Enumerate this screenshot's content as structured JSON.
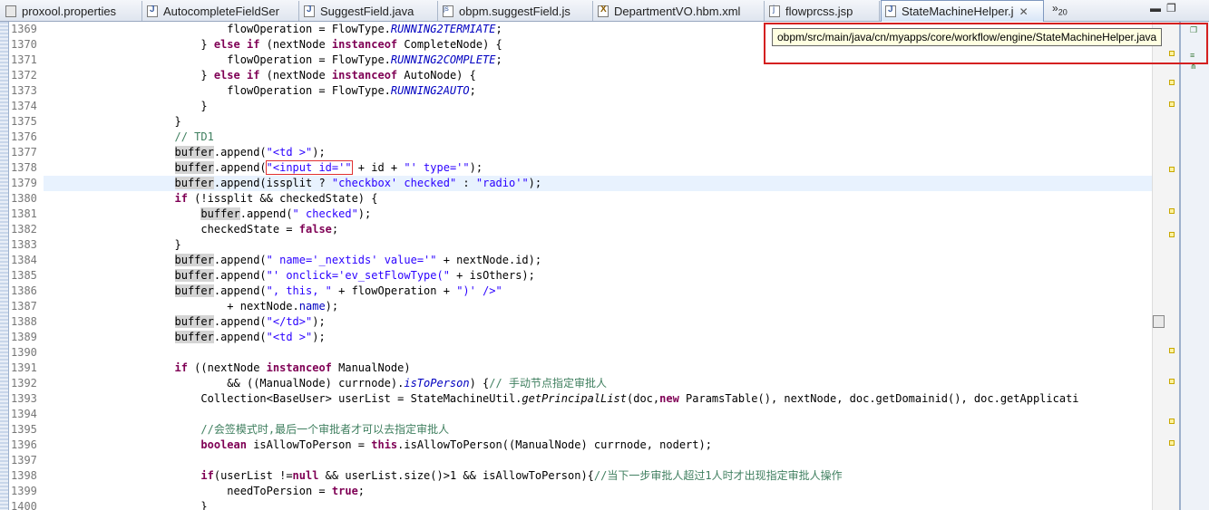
{
  "tabs": [
    {
      "label": "proxool.properties",
      "icon": "properties-file-icon",
      "active": false
    },
    {
      "label": "AutocompleteFieldSer",
      "icon": "java-file-icon",
      "active": false
    },
    {
      "label": "SuggestField.java",
      "icon": "java-file-icon",
      "active": false
    },
    {
      "label": "obpm.suggestField.js",
      "icon": "js-file-icon",
      "active": false
    },
    {
      "label": "DepartmentVO.hbm.xml",
      "icon": "xml-file-icon",
      "active": false
    },
    {
      "label": "flowprcss.jsp",
      "icon": "jsp-file-icon",
      "active": false
    },
    {
      "label": "StateMachineHelper.j",
      "icon": "java-file-icon",
      "active": true
    }
  ],
  "tab_overflow": {
    "symbol": "»",
    "count": "20"
  },
  "tooltip": {
    "text": "obpm/src/main/java/cn/myapps/core/workflow/engine/StateMachineHelper.java"
  },
  "editor": {
    "current_line": "1379",
    "line_numbers": [
      "1369",
      "1370",
      "1371",
      "1372",
      "1373",
      "1374",
      "1375",
      "1376",
      "1377",
      "1378",
      "1379",
      "1380",
      "1381",
      "1382",
      "1383",
      "1384",
      "1385",
      "1386",
      "1387",
      "1388",
      "1389",
      "1390",
      "1391",
      "1392",
      "1393",
      "1394",
      "1395",
      "1396",
      "1397",
      "1398",
      "1399",
      "1400"
    ]
  },
  "code": {
    "l1369": {
      "pre": "                            flowOperation = FlowType.",
      "f": "RUNNING2TERMIATE",
      "post": ";"
    },
    "l1370": {
      "pre": "                        } ",
      "k1": "else if",
      "mid": " (nextNode ",
      "k2": "instanceof",
      "post": " CompleteNode) {"
    },
    "l1371": {
      "pre": "                            flowOperation = FlowType.",
      "f": "RUNNING2COMPLETE",
      "post": ";"
    },
    "l1372": {
      "pre": "                        } ",
      "k1": "else if",
      "mid": " (nextNode ",
      "k2": "instanceof",
      "post": " AutoNode) {"
    },
    "l1373": {
      "pre": "                            flowOperation = FlowType.",
      "f": "RUNNING2AUTO",
      "post": ";"
    },
    "l1374": {
      "text": "                        }"
    },
    "l1375": {
      "text": "                    }"
    },
    "l1376": {
      "pre": "                    ",
      "c": "// TD1"
    },
    "l1377": {
      "pre": "                    ",
      "v": "buffer",
      "mid": ".append(",
      "s": "\"<td >\"",
      "post": ");"
    },
    "l1378": {
      "pre": "                    ",
      "v": "buffer",
      "mid": ".append(",
      "s": "\"<input id='\"",
      "mid2": " + id + ",
      "s2": "\"' type='\"",
      "post": ");"
    },
    "l1379": {
      "pre": "                    ",
      "v": "buffer",
      "mid": ".append(issplit ? ",
      "s": "\"checkbox' checked\"",
      "mid2": " : ",
      "s2": "\"radio'\"",
      "post": ");"
    },
    "l1380": {
      "pre": "                    ",
      "k1": "if",
      "post": " (!issplit && checkedState) {"
    },
    "l1381": {
      "pre": "                        ",
      "v": "buffer",
      "mid": ".append(",
      "s": "\" checked\"",
      "post": ");"
    },
    "l1382": {
      "pre": "                        checkedState = ",
      "k1": "false",
      "post": ";"
    },
    "l1383": {
      "text": "                    }"
    },
    "l1384": {
      "pre": "                    ",
      "v": "buffer",
      "mid": ".append(",
      "s": "\" name='_nextids' value='\"",
      "post": " + nextNode.id);"
    },
    "l1385": {
      "pre": "                    ",
      "v": "buffer",
      "mid": ".append(",
      "s": "\"' onclick='ev_setFlowType(\"",
      "post": " + isOthers);"
    },
    "l1386": {
      "pre": "                    ",
      "v": "buffer",
      "mid": ".append(",
      "s": "\", this, \"",
      "mid2": " + flowOperation + ",
      "s2": "\")' />\""
    },
    "l1387": {
      "pre": "                            + nextNode.",
      "f": "name",
      "post": ");"
    },
    "l1388": {
      "pre": "                    ",
      "v": "buffer",
      "mid": ".append(",
      "s": "\"</td>\"",
      "post": ");"
    },
    "l1389": {
      "pre": "                    ",
      "v": "buffer",
      "mid": ".append(",
      "s": "\"<td >\"",
      "post": ");"
    },
    "l1390": {
      "text": ""
    },
    "l1391": {
      "pre": "                    ",
      "k1": "if",
      "mid": " ((nextNode ",
      "k2": "instanceof",
      "post": " ManualNode)"
    },
    "l1392": {
      "pre": "                            && ((ManualNode) currnode).",
      "f": "isToPerson",
      "mid": ") {",
      "c": "// 手动节点指定审批人"
    },
    "l1393": {
      "pre": "                        Collection<BaseUser> userList = StateMachineUtil.",
      "m": "getPrincipalList",
      "mid": "(doc,",
      "k1": "new",
      "post": " ParamsTable(), nextNode, doc.getDomainid(), doc.getApplicati"
    },
    "l1394": {
      "text": ""
    },
    "l1395": {
      "pre": "                        ",
      "c": "//会签模式时,最后一个审批者才可以去指定审批人"
    },
    "l1396": {
      "pre": "                        ",
      "k1": "boolean",
      "mid": " isAllowToPerson = ",
      "k2": "this",
      "post": ".isAllowToPerson((ManualNode) currnode, nodert);"
    },
    "l1397": {
      "text": ""
    },
    "l1398": {
      "pre": "                        ",
      "k1": "if",
      "mid": "(userList !=",
      "k2": "null",
      "post": " && userList.size()>1 && isAllowToPerson){",
      "c": "//当下一步审批人超过1人时才出现指定审批人操作"
    },
    "l1399": {
      "pre": "                            needToPersion = ",
      "k1": "true",
      "post": ";"
    },
    "l1400": {
      "text": "                        }"
    }
  }
}
